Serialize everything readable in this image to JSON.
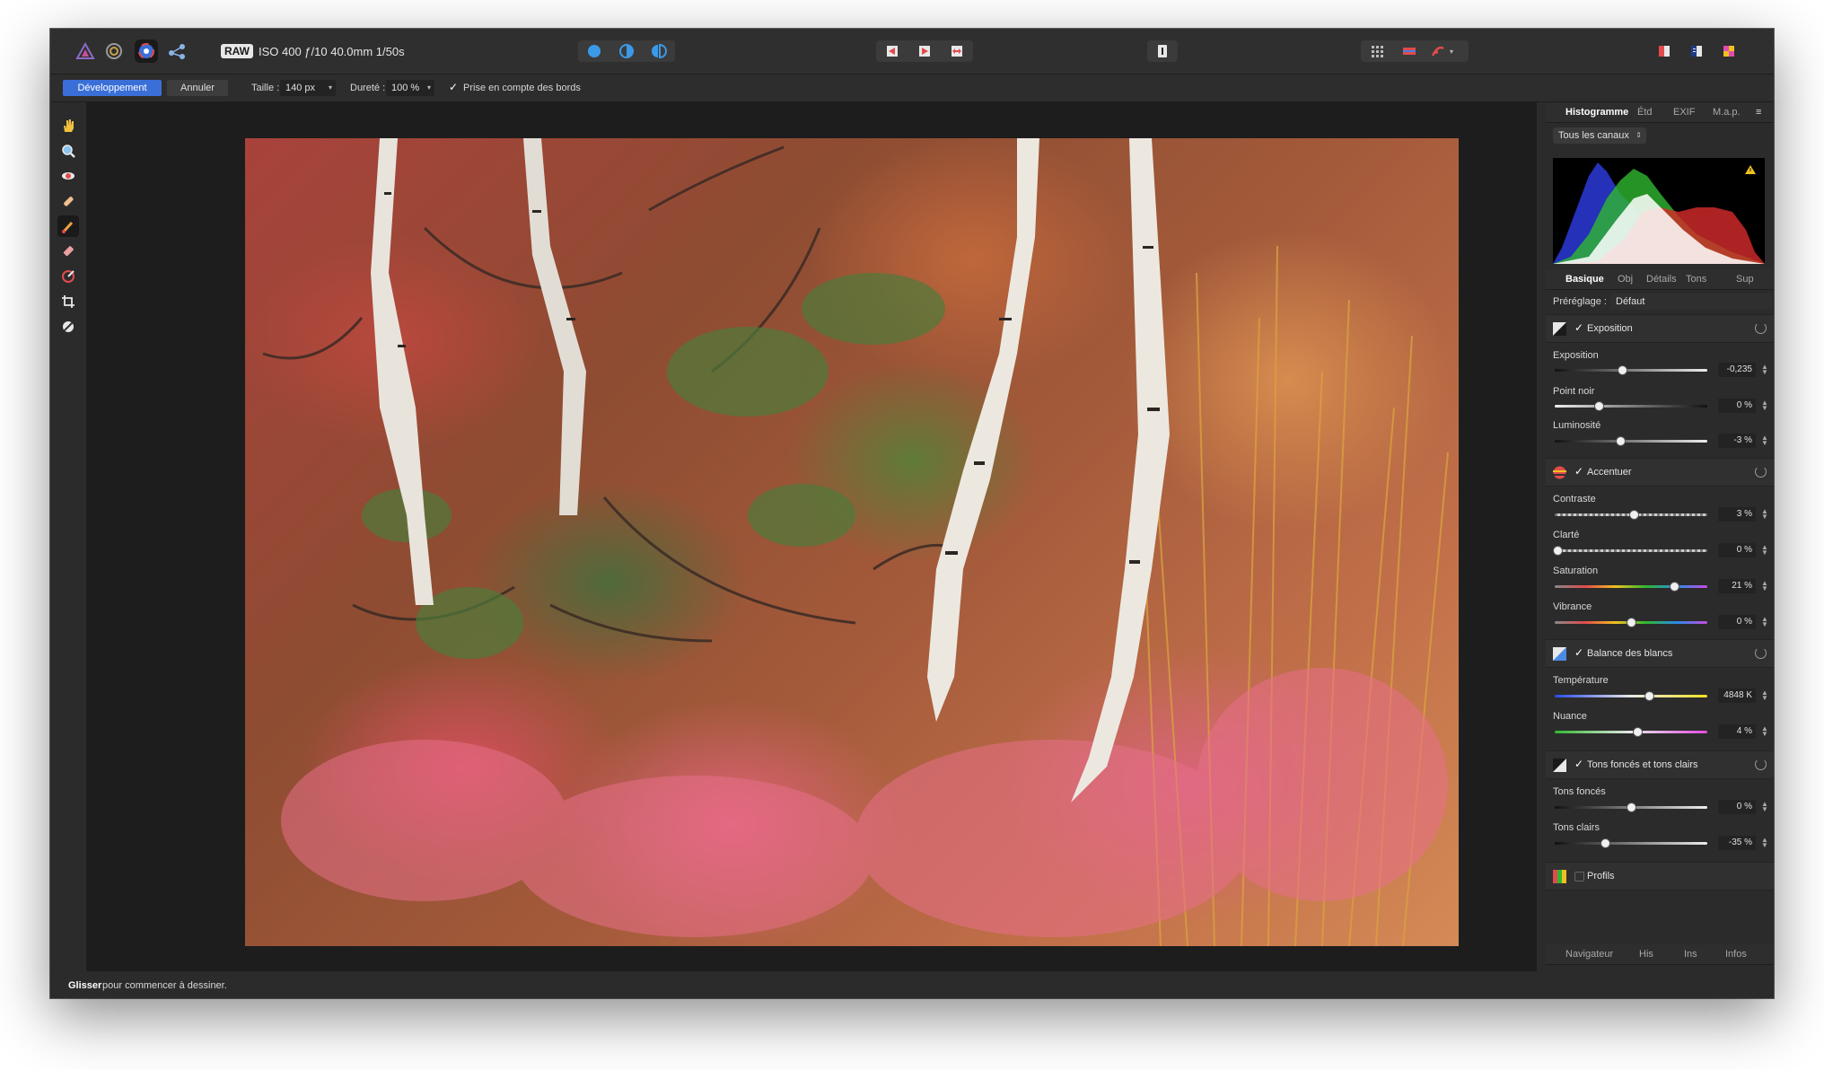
{
  "toolbar": {
    "raw_badge": "RAW",
    "raw_info": "ISO 400 ƒ/10 40.0mm 1/50s"
  },
  "context": {
    "develop_label": "Développement",
    "cancel_label": "Annuler",
    "size_label": "Taille :",
    "size_value": "140 px",
    "hardness_label": "Dureté :",
    "hardness_value": "100 %",
    "edges_check": "✓",
    "edges_label": "Prise en compte des bords"
  },
  "panel_top": {
    "tabs": [
      "Histogramme",
      "Étd",
      "EXIF",
      "M.a.p."
    ],
    "channel_select": "Tous les canaux"
  },
  "panel_mid": {
    "tabs": [
      "Basique",
      "Obj",
      "Détails",
      "Tons",
      "Sup"
    ],
    "preset_label": "Préréglage :",
    "preset_value": "Défaut"
  },
  "sections": {
    "exposure": {
      "title": "Exposition",
      "check": "✓",
      "sliders": [
        {
          "label": "Exposition",
          "value": "-0,235",
          "pos": 0.44
        },
        {
          "label": "Point noir",
          "value": "0 %",
          "pos": 0.29
        },
        {
          "label": "Luminosité",
          "value": "-3 %",
          "pos": 0.43
        }
      ]
    },
    "enhance": {
      "title": "Accentuer",
      "check": "✓",
      "sliders": [
        {
          "label": "Contraste",
          "value": "3 %",
          "pos": 0.52
        },
        {
          "label": "Clarté",
          "value": "0 %",
          "pos": 0.02
        },
        {
          "label": "Saturation",
          "value": "21 %",
          "pos": 0.78
        },
        {
          "label": "Vibrance",
          "value": "0 %",
          "pos": 0.5
        }
      ]
    },
    "white_balance": {
      "title": "Balance des blancs",
      "check": "✓",
      "sliders": [
        {
          "label": "Température",
          "value": "4848 K",
          "pos": 0.62
        },
        {
          "label": "Nuance",
          "value": "4 %",
          "pos": 0.54
        }
      ]
    },
    "shadows_highlights": {
      "title": "Tons foncés et tons clairs",
      "check": "✓",
      "sliders": [
        {
          "label": "Tons foncés",
          "value": "0 %",
          "pos": 0.5
        },
        {
          "label": "Tons clairs",
          "value": "-35 %",
          "pos": 0.33
        }
      ]
    },
    "profiles": {
      "title": "Profils"
    }
  },
  "panel_bottom": {
    "tabs": [
      "Navigateur",
      "His",
      "Ins",
      "Infos"
    ]
  },
  "status": {
    "bold": "Glisser",
    "rest": " pour commencer à dessiner."
  },
  "colors": {
    "accent": "#3a6fd8",
    "window_bg": "#2b2b2b",
    "canvas_bg": "#1d1d1d"
  }
}
